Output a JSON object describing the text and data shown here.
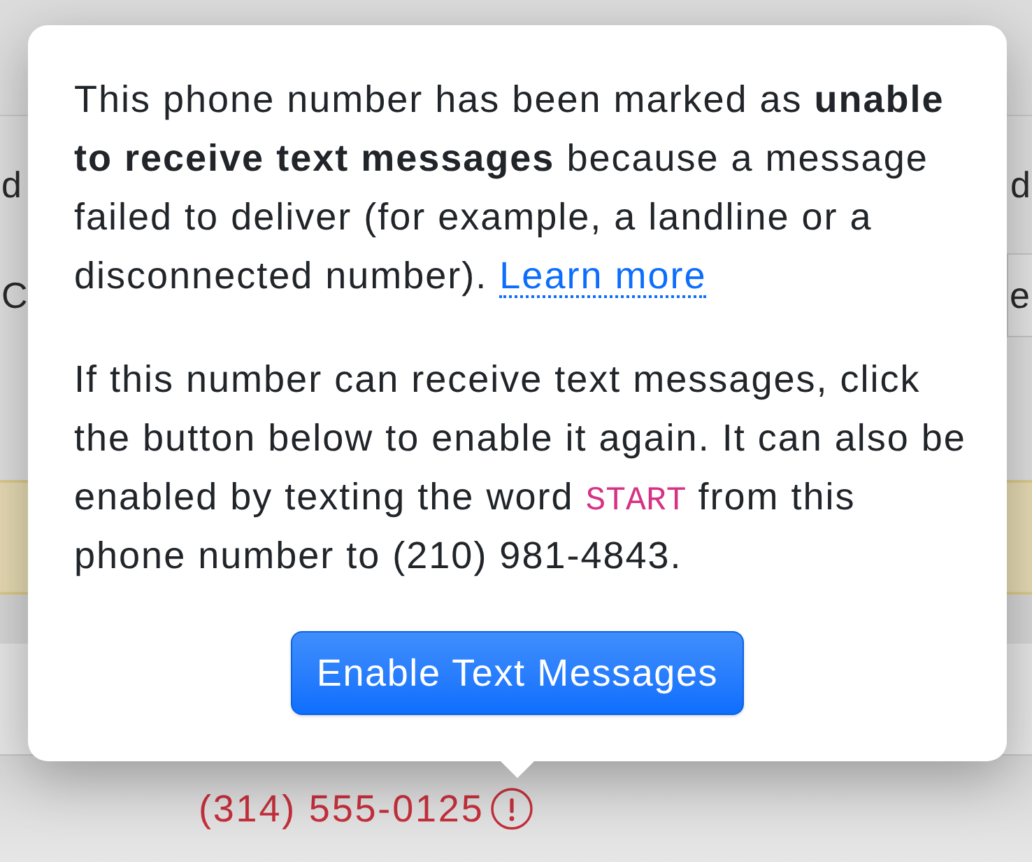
{
  "background_page": {
    "rows": [
      {
        "left": "d",
        "right": {
          "kind": "text",
          "text": "d"
        }
      },
      {
        "left": "C",
        "right": {
          "kind": "field",
          "text": "e"
        }
      }
    ]
  },
  "popover": {
    "paragraphs": [
      {
        "kind": "text_link",
        "text": "This phone number has been marked as **unable to receive text messages** because a message failed to deliver (for example, a landline or a disconnected number).",
        "link": "Learn more"
      },
      {
        "kind": "text_code",
        "before": "If this number can receive text messages, click the button below to enable it again. It can also be enabled by texting the word",
        "code": "START",
        "after": "from this phone number to (210) 981-4843."
      }
    ],
    "button": "Enable Text Messages"
  },
  "phone_number": {
    "text": "(314) 555-0125",
    "warning": true
  }
}
